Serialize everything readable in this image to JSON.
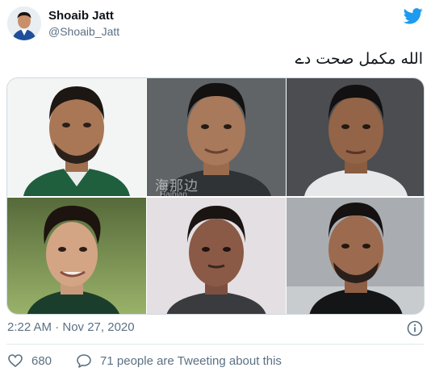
{
  "user": {
    "name": "Shoaib Jatt",
    "handle": "@Shoaib_Jatt"
  },
  "tweet": {
    "text": "الله مکمل صحت دے"
  },
  "media": {
    "photo_count": 6,
    "watermark": {
      "text": "海那边",
      "subtext": "Haibian"
    }
  },
  "meta": {
    "timestamp": "2:22 AM · Nov 27, 2020"
  },
  "actions": {
    "like_count": "680",
    "tweeting_text": "71 people are Tweeting about this"
  },
  "colors": {
    "twitter_blue": "#1d9bf0",
    "muted_text": "#5b7083",
    "border": "#cfd9de"
  },
  "icons": [
    "twitter-bird-icon",
    "info-icon",
    "heart-icon",
    "speech-bubble-icon"
  ]
}
